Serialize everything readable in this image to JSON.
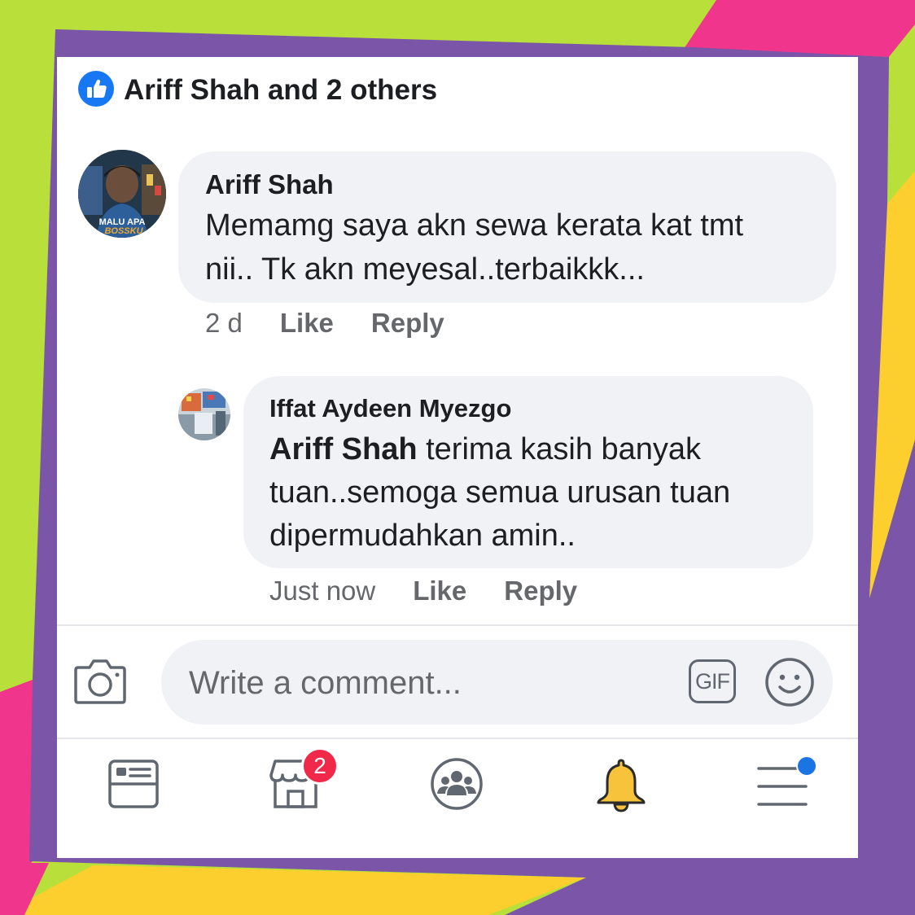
{
  "colors": {
    "lime": "#b8df3a",
    "magenta": "#f0368c",
    "purple": "#7b55a8",
    "yellow": "#fcce2e",
    "facebook_blue": "#1877f2"
  },
  "likes": {
    "icon": "thumbs-up-icon",
    "text": "Ariff Shah and 2 others"
  },
  "comments": [
    {
      "author": "Ariff Shah",
      "avatar_caption_line1": "MALU APA",
      "avatar_caption_line2": "BOSSKU",
      "text_lines": [
        "Memamg saya akn sewa kerata kat tmt",
        "nii.. Tk akn meyesal..terbaikkk..."
      ],
      "time": "2 d",
      "like_label": "Like",
      "reply_label": "Reply"
    }
  ],
  "reply": {
    "author": "Iffat Aydeen Myezgo",
    "mention": "Ariff Shah",
    "text_line1_rest": " terima kasih banyak",
    "text_line2": "tuan..semoga semua urusan tuan",
    "text_line3": "dipermudahkan amin..",
    "time": "Just now",
    "like_label": "Like",
    "reply_label": "Reply"
  },
  "composer": {
    "camera_icon": "camera-icon",
    "placeholder": "Write a comment...",
    "gif_label": "GIF",
    "emoji_icon": "smiley-icon"
  },
  "bottom_nav": {
    "items": [
      "news-feed-icon",
      "marketplace-icon",
      "groups-icon",
      "notifications-bell-icon",
      "menu-icon"
    ],
    "marketplace_badge": "2"
  }
}
